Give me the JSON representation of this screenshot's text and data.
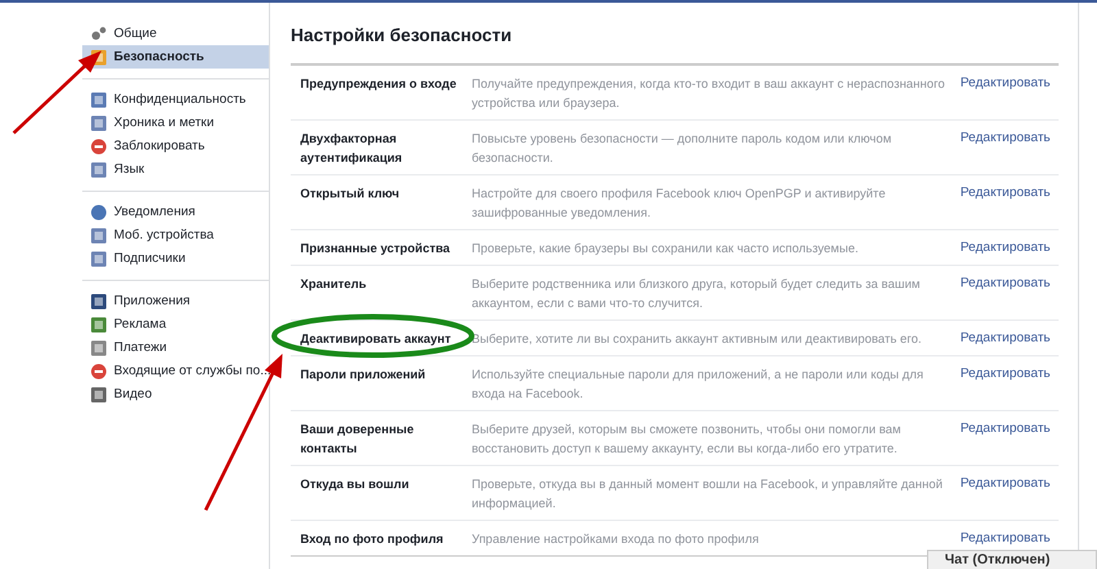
{
  "sidebar": {
    "groups": [
      {
        "items": [
          {
            "label": "Общие",
            "selected": false
          },
          {
            "label": "Безопасность",
            "selected": true
          }
        ]
      },
      {
        "items": [
          {
            "label": "Конфиденциальность",
            "selected": false
          },
          {
            "label": "Хроника и метки",
            "selected": false
          },
          {
            "label": "Заблокировать",
            "selected": false
          },
          {
            "label": "Язык",
            "selected": false
          }
        ]
      },
      {
        "items": [
          {
            "label": "Уведомления",
            "selected": false
          },
          {
            "label": "Моб. устройства",
            "selected": false
          },
          {
            "label": "Подписчики",
            "selected": false
          }
        ]
      },
      {
        "items": [
          {
            "label": "Приложения",
            "selected": false
          },
          {
            "label": "Реклама",
            "selected": false
          },
          {
            "label": "Платежи",
            "selected": false
          },
          {
            "label": "Входящие от службы по...",
            "selected": false
          },
          {
            "label": "Видео",
            "selected": false
          }
        ]
      }
    ]
  },
  "main": {
    "title": "Настройки безопасности",
    "settings": [
      {
        "name": "Предупреждения о входе",
        "description": "Получайте предупреждения, когда кто-то входит в ваш аккаунт с нераспознанного устройства или браузера.",
        "action": "Редактировать"
      },
      {
        "name": "Двухфакторная аутентификация",
        "description": "Повысьте уровень безопасности — дополните пароль кодом или ключом безопасности.",
        "action": "Редактировать"
      },
      {
        "name": "Открытый ключ",
        "description": "Настройте для своего профиля Facebook ключ OpenPGP и активируйте зашифрованные уведомления.",
        "action": "Редактировать"
      },
      {
        "name": "Признанные устройства",
        "description": "Проверьте, какие браузеры вы сохранили как часто используемые.",
        "action": "Редактировать"
      },
      {
        "name": "Хранитель",
        "description": "Выберите родственника или близкого друга, который будет следить за вашим аккаунтом, если с вами что-то случится.",
        "action": "Редактировать"
      },
      {
        "name": "Деактивировать аккаунт",
        "description": "Выберите, хотите ли вы сохранить аккаунт активным или деактивировать его.",
        "action": "Редактировать"
      },
      {
        "name": "Пароли приложений",
        "description": "Используйте специальные пароли для приложений, а не пароли или коды для входа на Facebook.",
        "action": "Редактировать"
      },
      {
        "name": "Ваши доверенные контакты",
        "description": "Выберите друзей, которым вы сможете позвонить, чтобы они помогли вам восстановить доступ к вашему аккаунту, если вы когда-либо его утратите.",
        "action": "Редактировать"
      },
      {
        "name": "Откуда вы вошли",
        "description": "Проверьте, откуда вы в данный момент вошли на Facebook, и управляйте данной информацией.",
        "action": "Редактировать"
      },
      {
        "name": "Вход по фото профиля",
        "description": "Управление настройками входа по фото профиля",
        "action": "Редактировать"
      }
    ]
  },
  "chat": {
    "label": "Чат (Отключен)"
  }
}
